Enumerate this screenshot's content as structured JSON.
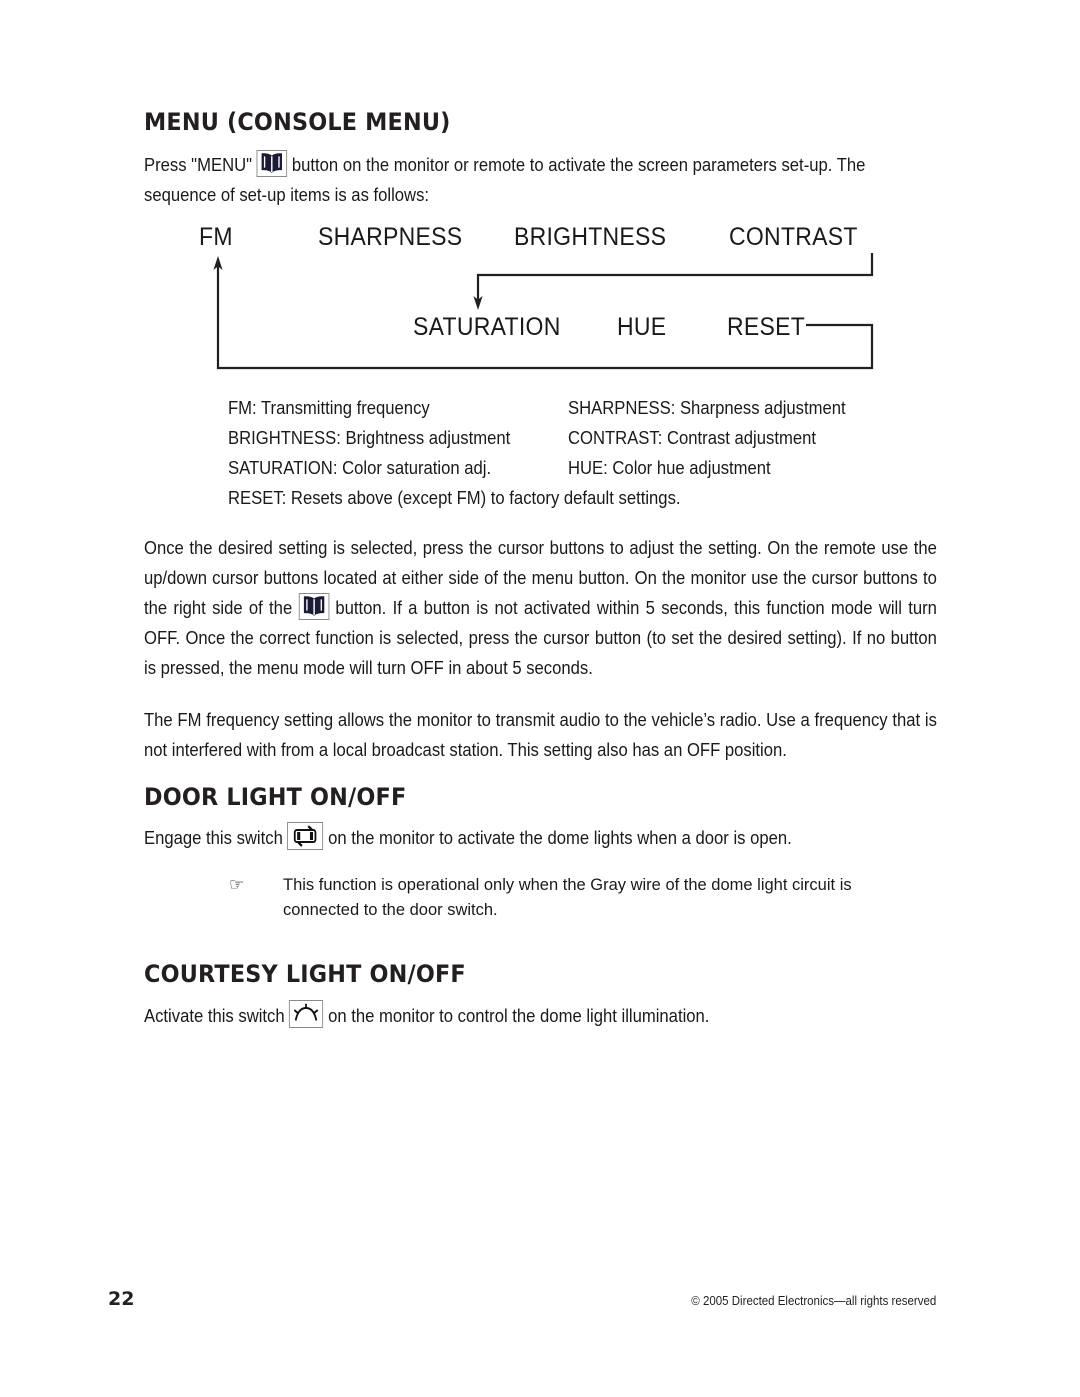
{
  "document": {
    "page_number": "22",
    "copyright": "© 2005 Directed Electronics—all rights reserved"
  },
  "sections": {
    "menu": {
      "heading": "MENU (CONSOLE MENU)",
      "intro_before_icon": "Press \"MENU\"",
      "menu_icon": "book-icon",
      "intro_after_icon": "button on the monitor or remote to activate the screen parameters set-up. The sequence of set-up items is as follows:",
      "paragraph_once_part1": "Once the desired setting is selected, press the cursor buttons to adjust the setting. On the remote use the up/down cursor buttons located at either side of the menu button. On the monitor use the cursor buttons to the right side of the",
      "paragraph_once_part2": "button. If a button is not activated within 5 seconds, this function mode will turn OFF. Once the correct function is selected, press the cursor button (to set the desired setting). If no button is pressed, the menu mode will turn OFF in about 5 seconds.",
      "paragraph_fm": "The FM frequency setting allows the monitor to transmit audio to the vehicle’s radio. Use a frequency that is not interfered with from a local broadcast station. This setting also has an OFF position."
    },
    "door_light": {
      "heading": "DOOR LIGHT ON/OFF",
      "text_before_icon": "Engage this switch",
      "switch_icon": "door-light-icon",
      "text_after_icon": "on the monitor to activate the dome lights when a door is open.",
      "note_bullet": "pointing-hand-icon",
      "note_text": "This function is operational only when the Gray wire of the dome light circuit is connected to the door switch."
    },
    "courtesy_light": {
      "heading": "COURTESY LIGHT ON/OFF",
      "text_before_icon": "Activate this switch",
      "switch_icon": "dome-light-icon",
      "text_after_icon": "on the monitor to control the dome light illumination."
    }
  },
  "flow_diagram": {
    "row_1": [
      "FM",
      "SHARPNESS",
      "BRIGHTNESS",
      "CONTRAST"
    ],
    "row_2": [
      "SATURATION",
      "HUE",
      "RESET"
    ],
    "labels": {
      "fm": "FM",
      "sharpness": "SHARPNESS",
      "brightness": "BRIGHTNESS",
      "contrast": "CONTRAST",
      "saturation": "SATURATION",
      "hue": "HUE",
      "reset": "RESET"
    }
  },
  "definitions": {
    "rows": [
      {
        "left": "FM: Transmitting frequency",
        "right": "SHARPNESS: Sharpness adjustment"
      },
      {
        "left": "BRIGHTNESS: Brightness adjustment",
        "right": "CONTRAST: Contrast adjustment"
      },
      {
        "left": "SATURATION: Color saturation adj.",
        "right": "HUE: Color hue adjustment"
      }
    ],
    "reset_line": "RESET: Resets above (except FM) to factory default settings."
  }
}
